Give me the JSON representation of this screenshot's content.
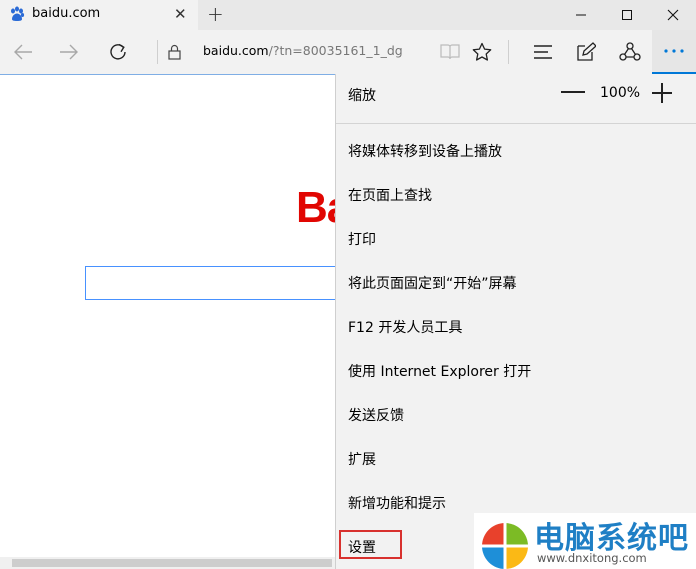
{
  "tab": {
    "title": "baidu.com",
    "close_glyph": "✕",
    "new_tab_glyph": "+"
  },
  "window": {
    "minimize_icon": "minimize-icon",
    "maximize_icon": "maximize-icon",
    "close_icon": "close-icon"
  },
  "address": {
    "host": "baidu.com",
    "rest": "/?tn=80035161_1_dg"
  },
  "page": {
    "logo_text": "Ba"
  },
  "menu": {
    "zoom_label": "缩放",
    "zoom_value": "100%",
    "zoom_plus": "+",
    "items": [
      "将媒体转移到设备上播放",
      "在页面上查找",
      "打印",
      "将此页面固定到“开始”屏幕",
      "F12 开发人员工具",
      "使用 Internet Explorer 打开",
      "发送反馈",
      "扩展",
      "新增功能和提示",
      "设置"
    ]
  },
  "watermark": {
    "title": "电脑系统吧",
    "url": "www.dnxitong.com"
  },
  "colors": {
    "accent": "#0078d7",
    "baidu_red": "#e10602",
    "highlight_red": "#d8312e",
    "watermark_blue": "#1f7fc5"
  }
}
